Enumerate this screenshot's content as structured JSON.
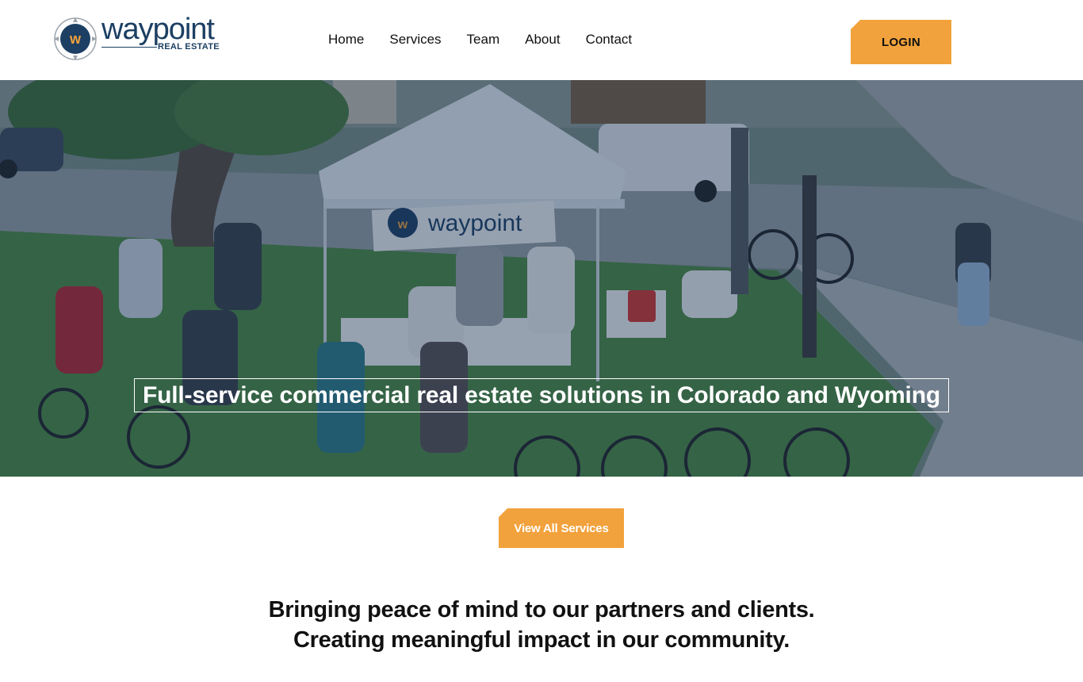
{
  "brand": {
    "logo_word": "waypoint",
    "logo_sub": "REAL ESTATE",
    "logo_initial": "w",
    "colors": {
      "navy": "#1c3f63",
      "accent": "#f2a23c"
    }
  },
  "nav": {
    "items": [
      {
        "label": "Home"
      },
      {
        "label": "Services"
      },
      {
        "label": "Team"
      },
      {
        "label": "About"
      },
      {
        "label": "Contact"
      }
    ],
    "login_label": "LOGIN"
  },
  "hero": {
    "title": "Full-service commercial real estate solutions in Colorado and Wyoming",
    "banner_text": "waypoint",
    "banner_initial": "w"
  },
  "cta": {
    "services_label": "View All Services"
  },
  "tagline": {
    "line1": "Bringing peace of mind to our partners and clients.",
    "line2": "Creating meaningful impact in our community."
  }
}
